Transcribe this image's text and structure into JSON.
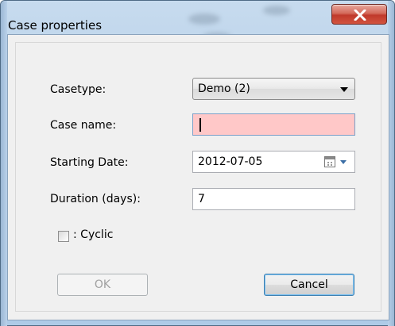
{
  "window": {
    "title": "Case properties"
  },
  "form": {
    "casetype_label": "Casetype:",
    "casetype_value": "Demo (2)",
    "case_name_label": "Case name:",
    "case_name_value": "",
    "starting_date_label": "Starting Date:",
    "starting_date_value": "2012-07-05",
    "duration_label": "Duration (days):",
    "duration_value": "7",
    "cyclic_label": ": Cyclic",
    "cyclic_checked": false
  },
  "buttons": {
    "ok_label": "OK",
    "cancel_label": "Cancel"
  },
  "colors": {
    "invalid_field": "#ffc8c8",
    "close_button": "#c0392b"
  },
  "icons": {
    "close": "close-icon",
    "calendar": "calendar-icon",
    "dropdown": "chevron-down-icon"
  }
}
